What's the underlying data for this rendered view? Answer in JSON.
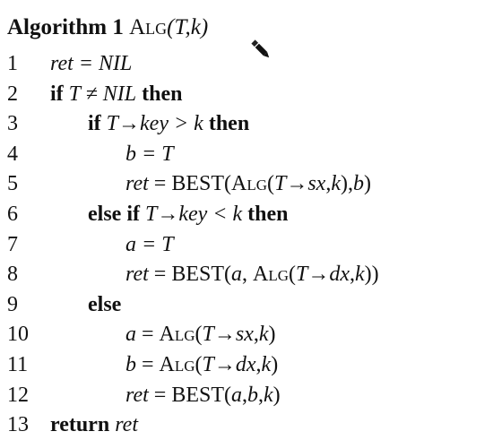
{
  "algorithm": {
    "label": "Algorithm 1",
    "name": "Alg",
    "params": "(T,k)"
  },
  "lines": [
    {
      "n": "1",
      "indent": 0,
      "parts": [
        {
          "t": "ret = NIL",
          "s": "it"
        }
      ]
    },
    {
      "n": "2",
      "indent": 0,
      "parts": [
        {
          "t": "if ",
          "s": "kw"
        },
        {
          "t": "T ≠ NIL",
          "s": "it"
        },
        {
          "t": " then",
          "s": "kw"
        }
      ]
    },
    {
      "n": "3",
      "indent": 1,
      "parts": [
        {
          "t": "if ",
          "s": "kw"
        },
        {
          "t": "T→key > k",
          "s": "it"
        },
        {
          "t": " then",
          "s": "kw"
        }
      ]
    },
    {
      "n": "4",
      "indent": 2,
      "parts": [
        {
          "t": "b = T",
          "s": "it"
        }
      ]
    },
    {
      "n": "5",
      "indent": 2,
      "parts": [
        {
          "t": "ret",
          "s": "it"
        },
        {
          "t": " = BEST(",
          "s": "rm"
        },
        {
          "t": "Alg",
          "s": "sc"
        },
        {
          "t": "(",
          "s": "rm"
        },
        {
          "t": "T→sx",
          "s": "it"
        },
        {
          "t": ",",
          "s": "rm"
        },
        {
          "t": "k",
          "s": "it"
        },
        {
          "t": "),",
          "s": "rm"
        },
        {
          "t": "b",
          "s": "it"
        },
        {
          "t": ")",
          "s": "rm"
        }
      ]
    },
    {
      "n": "6",
      "indent": 1,
      "parts": [
        {
          "t": "else if ",
          "s": "kw"
        },
        {
          "t": "T→key < k",
          "s": "it"
        },
        {
          "t": " then",
          "s": "kw"
        }
      ]
    },
    {
      "n": "7",
      "indent": 2,
      "parts": [
        {
          "t": "a = T",
          "s": "it"
        }
      ]
    },
    {
      "n": "8",
      "indent": 2,
      "parts": [
        {
          "t": "ret",
          "s": "it"
        },
        {
          "t": " = BEST(",
          "s": "rm"
        },
        {
          "t": "a",
          "s": "it"
        },
        {
          "t": ", ",
          "s": "rm"
        },
        {
          "t": "Alg",
          "s": "sc"
        },
        {
          "t": "(",
          "s": "rm"
        },
        {
          "t": "T→dx",
          "s": "it"
        },
        {
          "t": ",",
          "s": "rm"
        },
        {
          "t": "k",
          "s": "it"
        },
        {
          "t": "))",
          "s": "rm"
        }
      ]
    },
    {
      "n": "9",
      "indent": 1,
      "parts": [
        {
          "t": "else",
          "s": "kw"
        }
      ]
    },
    {
      "n": "10",
      "indent": 2,
      "parts": [
        {
          "t": "a",
          "s": "it"
        },
        {
          "t": " = ",
          "s": "rm"
        },
        {
          "t": "Alg",
          "s": "sc"
        },
        {
          "t": "(",
          "s": "rm"
        },
        {
          "t": "T→sx",
          "s": "it"
        },
        {
          "t": ",",
          "s": "rm"
        },
        {
          "t": "k",
          "s": "it"
        },
        {
          "t": ")",
          "s": "rm"
        }
      ]
    },
    {
      "n": "11",
      "indent": 2,
      "parts": [
        {
          "t": "b",
          "s": "it"
        },
        {
          "t": " = ",
          "s": "rm"
        },
        {
          "t": "Alg",
          "s": "sc"
        },
        {
          "t": "(",
          "s": "rm"
        },
        {
          "t": "T→dx",
          "s": "it"
        },
        {
          "t": ",",
          "s": "rm"
        },
        {
          "t": "k",
          "s": "it"
        },
        {
          "t": ")",
          "s": "rm"
        }
      ]
    },
    {
      "n": "12",
      "indent": 2,
      "parts": [
        {
          "t": "ret",
          "s": "it"
        },
        {
          "t": " = BEST(",
          "s": "rm"
        },
        {
          "t": "a",
          "s": "it"
        },
        {
          "t": ",",
          "s": "rm"
        },
        {
          "t": "b",
          "s": "it"
        },
        {
          "t": ",",
          "s": "rm"
        },
        {
          "t": "k",
          "s": "it"
        },
        {
          "t": ")",
          "s": "rm"
        }
      ]
    },
    {
      "n": "13",
      "indent": 0,
      "parts": [
        {
          "t": "return ",
          "s": "kw"
        },
        {
          "t": "ret",
          "s": "it"
        }
      ]
    }
  ],
  "cursor_icon": "pencil-icon"
}
